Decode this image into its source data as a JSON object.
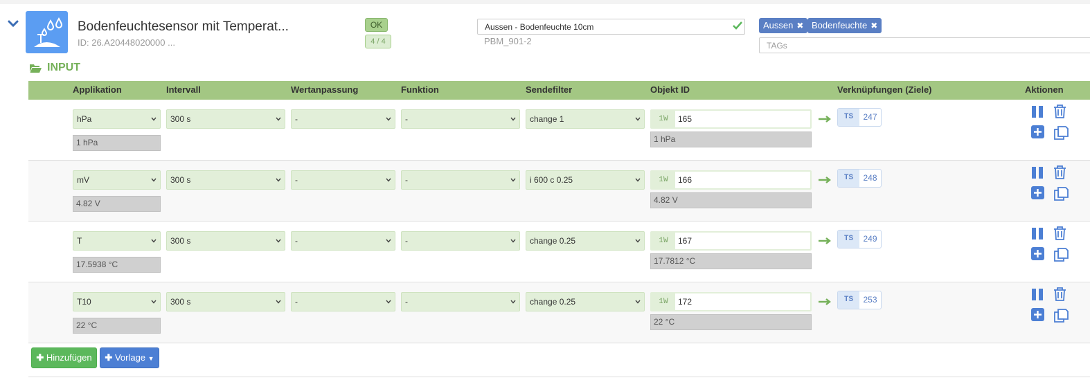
{
  "device": {
    "name": "Bodenfeuchtesensor mit Temperat...",
    "id": "ID: 26.A20448020000 ...",
    "status": "OK",
    "count": "4 / 4",
    "display_name": "Aussen - Bodenfeuchte 10cm",
    "subname": "PBM_901-2",
    "tags": [
      "Aussen",
      "Bodenfeuchte"
    ],
    "tags_placeholder": "TAGs"
  },
  "section": {
    "title": "INPUT"
  },
  "columns": {
    "applikation": "Applikation",
    "intervall": "Intervall",
    "wertanpassung": "Wertanpassung",
    "funktion": "Funktion",
    "sendefilter": "Sendefilter",
    "objekt_id": "Objekt ID",
    "verknuepfungen": "Verknüpfungen (Ziele)",
    "aktionen": "Aktionen"
  },
  "rows": [
    {
      "applikation": "hPa",
      "applikation_value": "1 hPa",
      "intervall": "300 s",
      "wertanpassung": "-",
      "funktion": "-",
      "sendefilter": "change 1",
      "objekt_prefix": "1W",
      "objekt_id": "165",
      "objekt_value": "1 hPa",
      "target_type": "TS",
      "target_id": "247"
    },
    {
      "applikation": "mV",
      "applikation_value": "4.82 V",
      "intervall": "300 s",
      "wertanpassung": "-",
      "funktion": "-",
      "sendefilter": "i 600 c 0.25",
      "objekt_prefix": "1W",
      "objekt_id": "166",
      "objekt_value": "4.82 V",
      "target_type": "TS",
      "target_id": "248"
    },
    {
      "applikation": "T",
      "applikation_value": "17.5938 °C",
      "intervall": "300 s",
      "wertanpassung": "-",
      "funktion": "-",
      "sendefilter": "change 0.25",
      "objekt_prefix": "1W",
      "objekt_id": "167",
      "objekt_value": "17.7812 °C",
      "target_type": "TS",
      "target_id": "249"
    },
    {
      "applikation": "T10",
      "applikation_value": "22 °C",
      "intervall": "300 s",
      "wertanpassung": "-",
      "funktion": "-",
      "sendefilter": "change 0.25",
      "objekt_prefix": "1W",
      "objekt_id": "172",
      "objekt_value": "22 °C",
      "target_type": "TS",
      "target_id": "253"
    }
  ],
  "buttons": {
    "add": "Hinzufügen",
    "template": "Vorlage"
  },
  "colors": {
    "accent_green": "#76b15a",
    "header_green": "#a3c783",
    "field_green": "#e2efd9",
    "accent_blue": "#5a7fc4",
    "device_icon": "#5b9df2"
  }
}
